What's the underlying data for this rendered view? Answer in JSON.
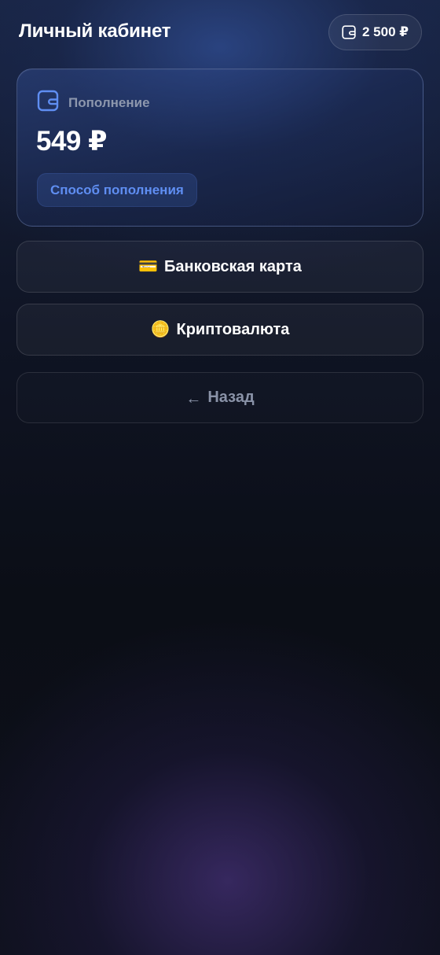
{
  "header": {
    "title": "Личный кабинет",
    "balance": "2 500 ₽",
    "balance_icon": "wallet-icon"
  },
  "topup": {
    "label": "Пополнение",
    "icon": "wallet-icon",
    "amount": "549 ₽",
    "method_chip": "Способ пополнения",
    "accent_color": "#5f8ef2"
  },
  "options": [
    {
      "icon": "credit-card-icon",
      "emoji": "💳",
      "label": "Банковская карта"
    },
    {
      "icon": "coin-icon",
      "emoji": "🪙",
      "label": "Криптовалюта"
    }
  ],
  "back": {
    "icon": "arrow-left-icon",
    "arrow": "←",
    "label": "Назад"
  }
}
